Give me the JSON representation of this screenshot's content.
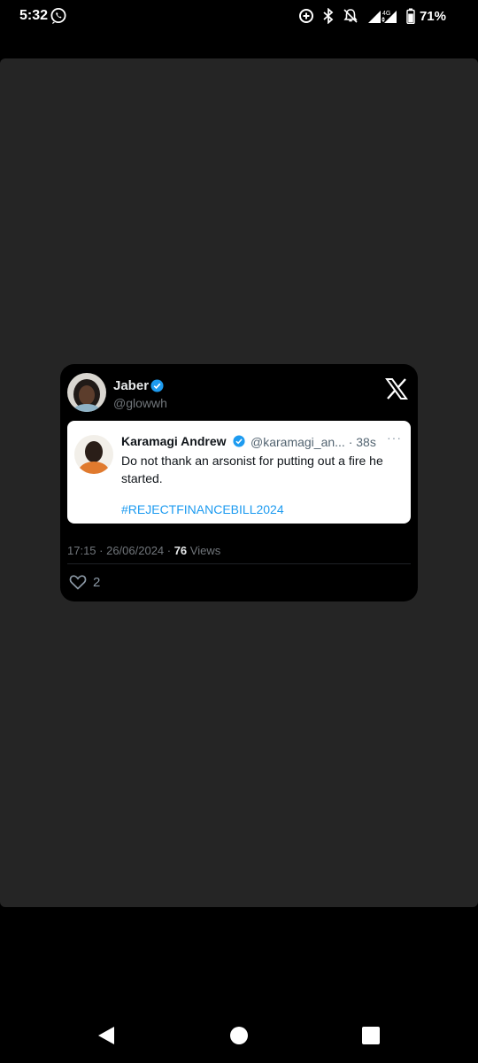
{
  "status_bar": {
    "time": "5:32",
    "battery_percent": "71%",
    "network": "4G",
    "icons": [
      "whatsapp-icon",
      "data-saver-icon",
      "bluetooth-icon",
      "alarm-off-icon",
      "signal-icon",
      "battery-icon"
    ]
  },
  "tweet": {
    "author": {
      "name": "Jaber",
      "handle": "@glowwh",
      "verified": true
    },
    "quoted": {
      "author_name": "Karamagi Andrew",
      "handle_time": "@karamagi_an... · 38s",
      "more": "···",
      "text": "Do not thank an arsonist for putting out a fire he started.",
      "hashtag": "#REJECTFINANCEBILL2024"
    },
    "meta": {
      "datetime": "17:15 · 26/06/2024 · ",
      "views_count": "76",
      "views_label": " Views"
    },
    "likes": "2"
  },
  "colors": {
    "background": "#000000",
    "viewer_panel": "#252525",
    "card": "#000000",
    "quote_card": "#ffffff",
    "verified_blue": "#1d9bf0",
    "hashtag": "#1d9bf0",
    "muted_text": "#71767b"
  },
  "nav": {
    "icons": [
      "back-icon",
      "home-icon",
      "recents-icon"
    ]
  }
}
